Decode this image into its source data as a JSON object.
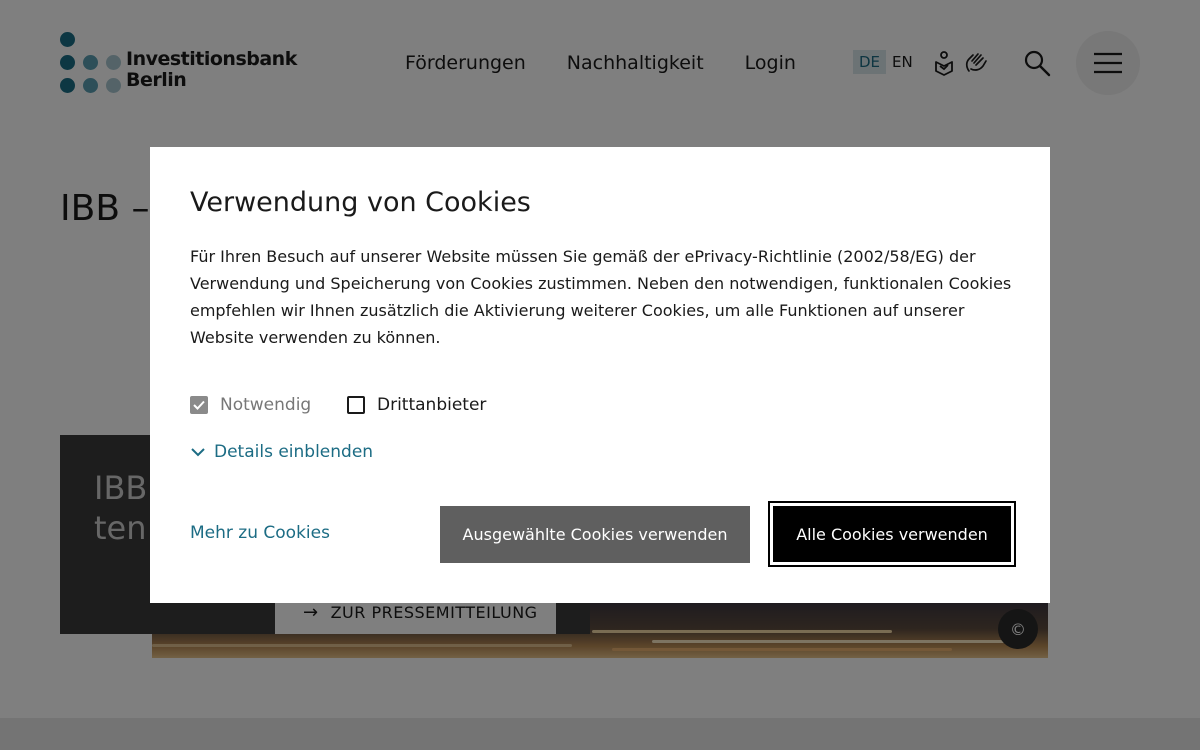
{
  "header": {
    "logo": {
      "line1": "Investitionsbank",
      "line2": "Berlin"
    },
    "nav": [
      {
        "label": "Förderungen"
      },
      {
        "label": "Nachhaltigkeit"
      },
      {
        "label": "Login"
      }
    ],
    "languages": {
      "active": "DE",
      "other": "EN"
    },
    "icons": [
      "easy-language-icon",
      "sign-language-icon",
      "search-icon",
      "hamburger-menu-icon"
    ]
  },
  "page": {
    "title": "IBB –",
    "teaser": {
      "line1": "IBB",
      "line2": "ten"
    },
    "press_button": "ZUR PRESSEMITTEILUNG",
    "copyright_symbol": "©"
  },
  "cookie_dialog": {
    "title": "Verwendung von Cookies",
    "text": "Für Ihren Besuch auf unserer Website müssen Sie gemäß der ePrivacy-Richtlinie (2002/58/EG) der Verwendung und Speicherung von Cookies zustimmen. Neben den notwendigen, funktionalen Cookies empfehlen wir Ihnen zusätzlich die Aktivierung weiterer Cookies, um alle Funktionen auf unserer Website verwenden zu können.",
    "options": {
      "necessary": {
        "label": "Notwendig",
        "checked": true
      },
      "third_party": {
        "label": "Drittanbieter",
        "checked": false
      }
    },
    "details_link": "Details einblenden",
    "more_link": "Mehr zu Cookies",
    "btn_selected": "Ausgewählte Cookies verwenden",
    "btn_all": "Alle Cookies verwenden"
  },
  "colors": {
    "brand_teal": "#1c6c84",
    "logo_dark": "#1b6f86",
    "logo_mid": "#5a9fb3",
    "logo_light": "#a9c7d1",
    "overlay": "rgba(0,0,0,0.5)"
  }
}
